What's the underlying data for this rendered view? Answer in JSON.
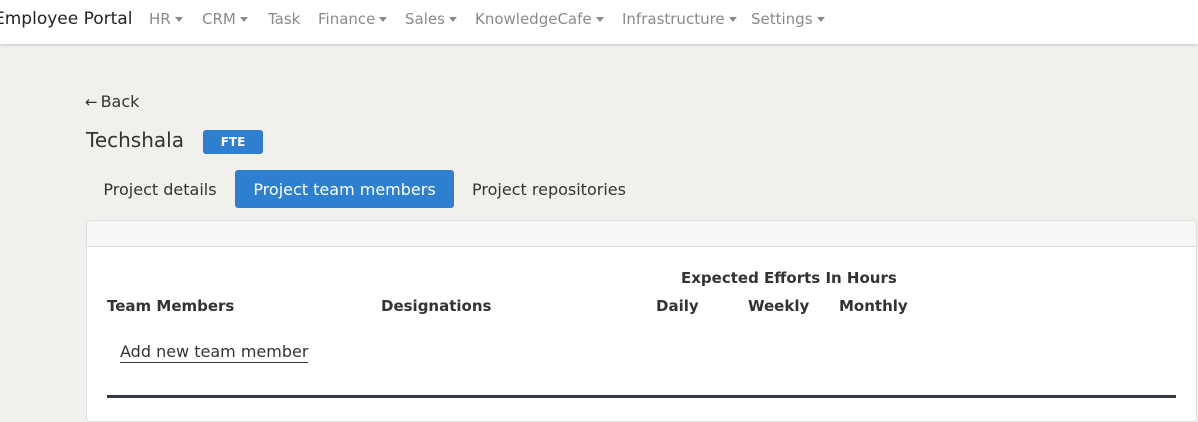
{
  "navbar": {
    "brand": "Employee Portal",
    "items": [
      {
        "label": "HR"
      },
      {
        "label": "CRM"
      },
      {
        "label": "Task"
      },
      {
        "label": "Finance"
      },
      {
        "label": "Sales"
      },
      {
        "label": "KnowledgeCafe"
      },
      {
        "label": "Infrastructure"
      },
      {
        "label": "Settings"
      }
    ]
  },
  "page": {
    "back_label": "Back",
    "back_icon": "arrow-left-icon",
    "project_name": "Techshala",
    "badge": "FTE"
  },
  "tabs": [
    {
      "label": "Project details",
      "active": false
    },
    {
      "label": "Project team members",
      "active": true
    },
    {
      "label": "Project repositories",
      "active": false
    }
  ],
  "table": {
    "group_header": "Expected Efforts In Hours",
    "columns": {
      "team_members": "Team Members",
      "designations": "Designations",
      "daily": "Daily",
      "weekly": "Weekly",
      "monthly": "Monthly"
    },
    "add_member_label": "Add new team member"
  },
  "colors": {
    "accent": "#2f7fd1",
    "background": "#f2f0ec"
  }
}
